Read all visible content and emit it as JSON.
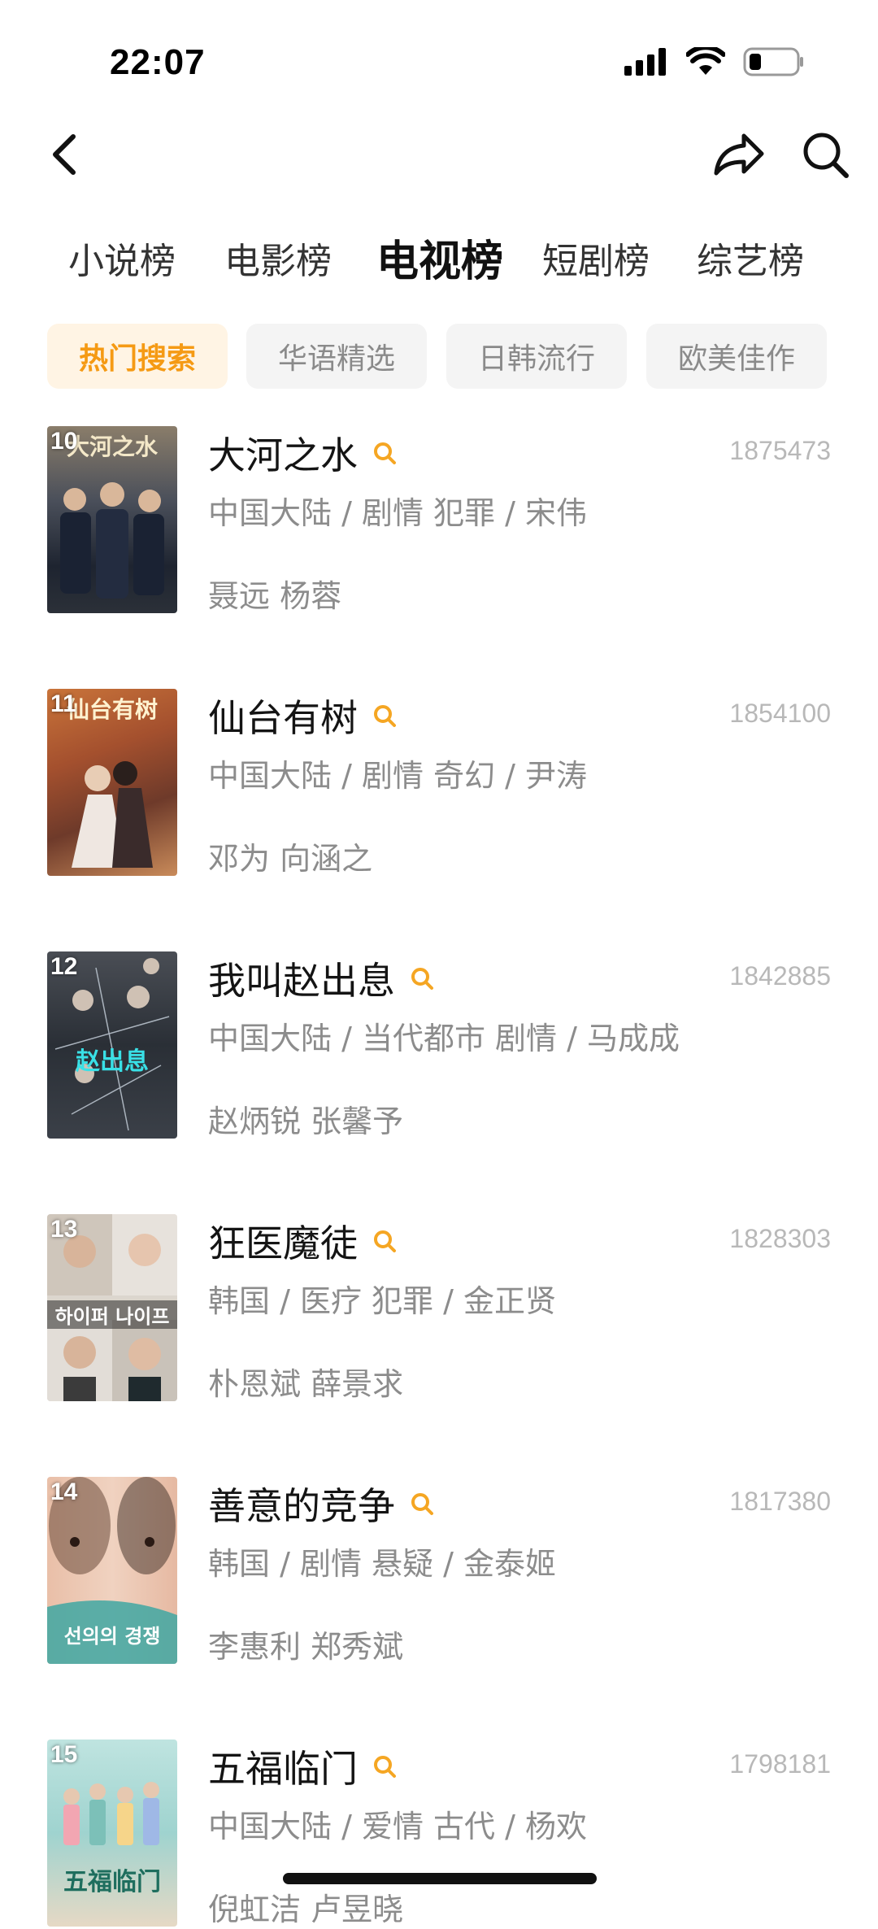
{
  "status_bar": {
    "time": "22:07"
  },
  "colors": {
    "accent": "#f59a14",
    "accent_bg": "#fff4e4",
    "text_primary": "#141414",
    "text_secondary": "#8c8c8c",
    "score": "#b8b8b8"
  },
  "header": {
    "back_icon": "chevron-left-icon",
    "share_icon": "share-arrow-icon",
    "search_icon": "search-icon"
  },
  "category_tabs": [
    {
      "label": "小说榜",
      "active": false
    },
    {
      "label": "电影榜",
      "active": false
    },
    {
      "label": "电视榜",
      "active": true
    },
    {
      "label": "短剧榜",
      "active": false
    },
    {
      "label": "综艺榜",
      "active": false
    }
  ],
  "sub_tabs": [
    {
      "label": "热门搜索",
      "active": true
    },
    {
      "label": "华语精选",
      "active": false
    },
    {
      "label": "日韩流行",
      "active": false
    },
    {
      "label": "欧美佳作",
      "active": false
    }
  ],
  "items": [
    {
      "rank": "10",
      "title": "大河之水",
      "score": "1875473",
      "meta": "中国大陆 / 剧情 犯罪 / 宋伟",
      "cast": "聂远 杨蓉"
    },
    {
      "rank": "11",
      "title": "仙台有树",
      "score": "1854100",
      "meta": "中国大陆 / 剧情 奇幻 / 尹涛",
      "cast": "邓为 向涵之"
    },
    {
      "rank": "12",
      "title": "我叫赵出息",
      "score": "1842885",
      "meta": "中国大陆 / 当代都市 剧情 / 马成成",
      "cast": "赵炳锐 张馨予"
    },
    {
      "rank": "13",
      "title": "狂医魔徒",
      "score": "1828303",
      "meta": "韩国 / 医疗 犯罪 / 金正贤",
      "cast": "朴恩斌 薛景求"
    },
    {
      "rank": "14",
      "title": "善意的竞争",
      "score": "1817380",
      "meta": "韩国 / 剧情 悬疑 / 金泰姬",
      "cast": "李惠利 郑秀斌"
    },
    {
      "rank": "15",
      "title": "五福临门",
      "score": "1798181",
      "meta": "中国大陆 / 爱情 古代 / 杨欢",
      "cast": "倪虹洁 卢昱晓"
    }
  ],
  "posters": [
    {
      "caption": "大河之水"
    },
    {
      "caption": "仙台有树"
    },
    {
      "caption": "赵出息"
    },
    {
      "caption": "하이퍼 나이프"
    },
    {
      "caption": "선의의 경쟁"
    },
    {
      "caption": "五福临门"
    }
  ]
}
